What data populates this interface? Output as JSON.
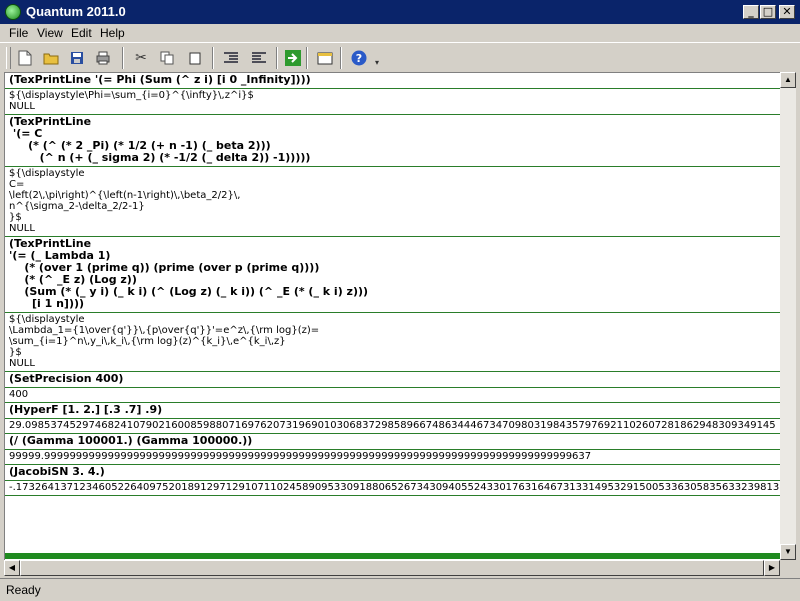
{
  "window": {
    "title": "Quantum 2011.0"
  },
  "menu": [
    "File",
    "View",
    "Edit",
    "Help"
  ],
  "toolbar": {
    "icons": [
      "new-document-icon",
      "open-folder-icon",
      "save-icon",
      "print-icon",
      "cut-icon",
      "copy-icon",
      "paste-icon",
      "indent-icon",
      "outdent-icon",
      "run-icon",
      "new-window-icon",
      "help-icon"
    ]
  },
  "cells": [
    {
      "input": "(TexPrintLine '(= Phi (Sum (^ z i) [i 0 _Infinity])))",
      "output": "${\\displaystyle\\Phi=\\sum_{i=0}^{\\infty}\\,z^i}$\nNULL"
    },
    {
      "input": "(TexPrintLine\n '(= C\n     (* (^ (* 2 _Pi) (* 1/2 (+ n -1) (_ beta 2)))\n        (^ n (+ (_ sigma 2) (* -1/2 (_ delta 2)) -1)))))",
      "output": "${\\displaystyle\nC=\n\\left(2\\,\\pi\\right)^{\\left(n-1\\right)\\,\\beta_2/2}\\,\nn^{\\sigma_2-\\delta_2/2-1}\n}$\nNULL"
    },
    {
      "input": "(TexPrintLine\n'(= (_ Lambda 1)\n    (* (over 1 (prime q)) (prime (over p (prime q))))\n    (* (^ _E z) (Log z))\n    (Sum (* (_ y i) (_ k i) (^ (Log z) (_ k i)) (^ _E (* (_ k i) z)))\n      [i 1 n])))",
      "output": "${\\displaystyle\n\\Lambda_1={1\\over{q'}}\\,{p\\over{q'}}'=e^z\\,{\\rm log}(z)=\n\\sum_{i=1}^n\\,y_i\\,k_i\\,{\\rm log}(z)^{k_i}\\,e^{k_i\\,z}\n}$\nNULL"
    },
    {
      "input": "(SetPrecision 400)",
      "output": "400"
    },
    {
      "input": "(HyperF [1. 2.] [.3 .7] .9)",
      "output": "29.098537452974682410790216008598807169762073196901030683729858966748634446734709803198435797692110260728186294830934914​5"
    },
    {
      "input": "(/ (Gamma 100001.) (Gamma 100000.))",
      "output": "99999.99999999999999999999999999999999999999999999999999999999999999999999999999999999999637"
    },
    {
      "input": "(JacobiSN 3. 4.)",
      "output": "-.17326413712346052264097520189129712910711024589095330918806526734309405524330176316467313314953291500533630583563323981​3"
    }
  ],
  "status": {
    "text": "Ready"
  }
}
